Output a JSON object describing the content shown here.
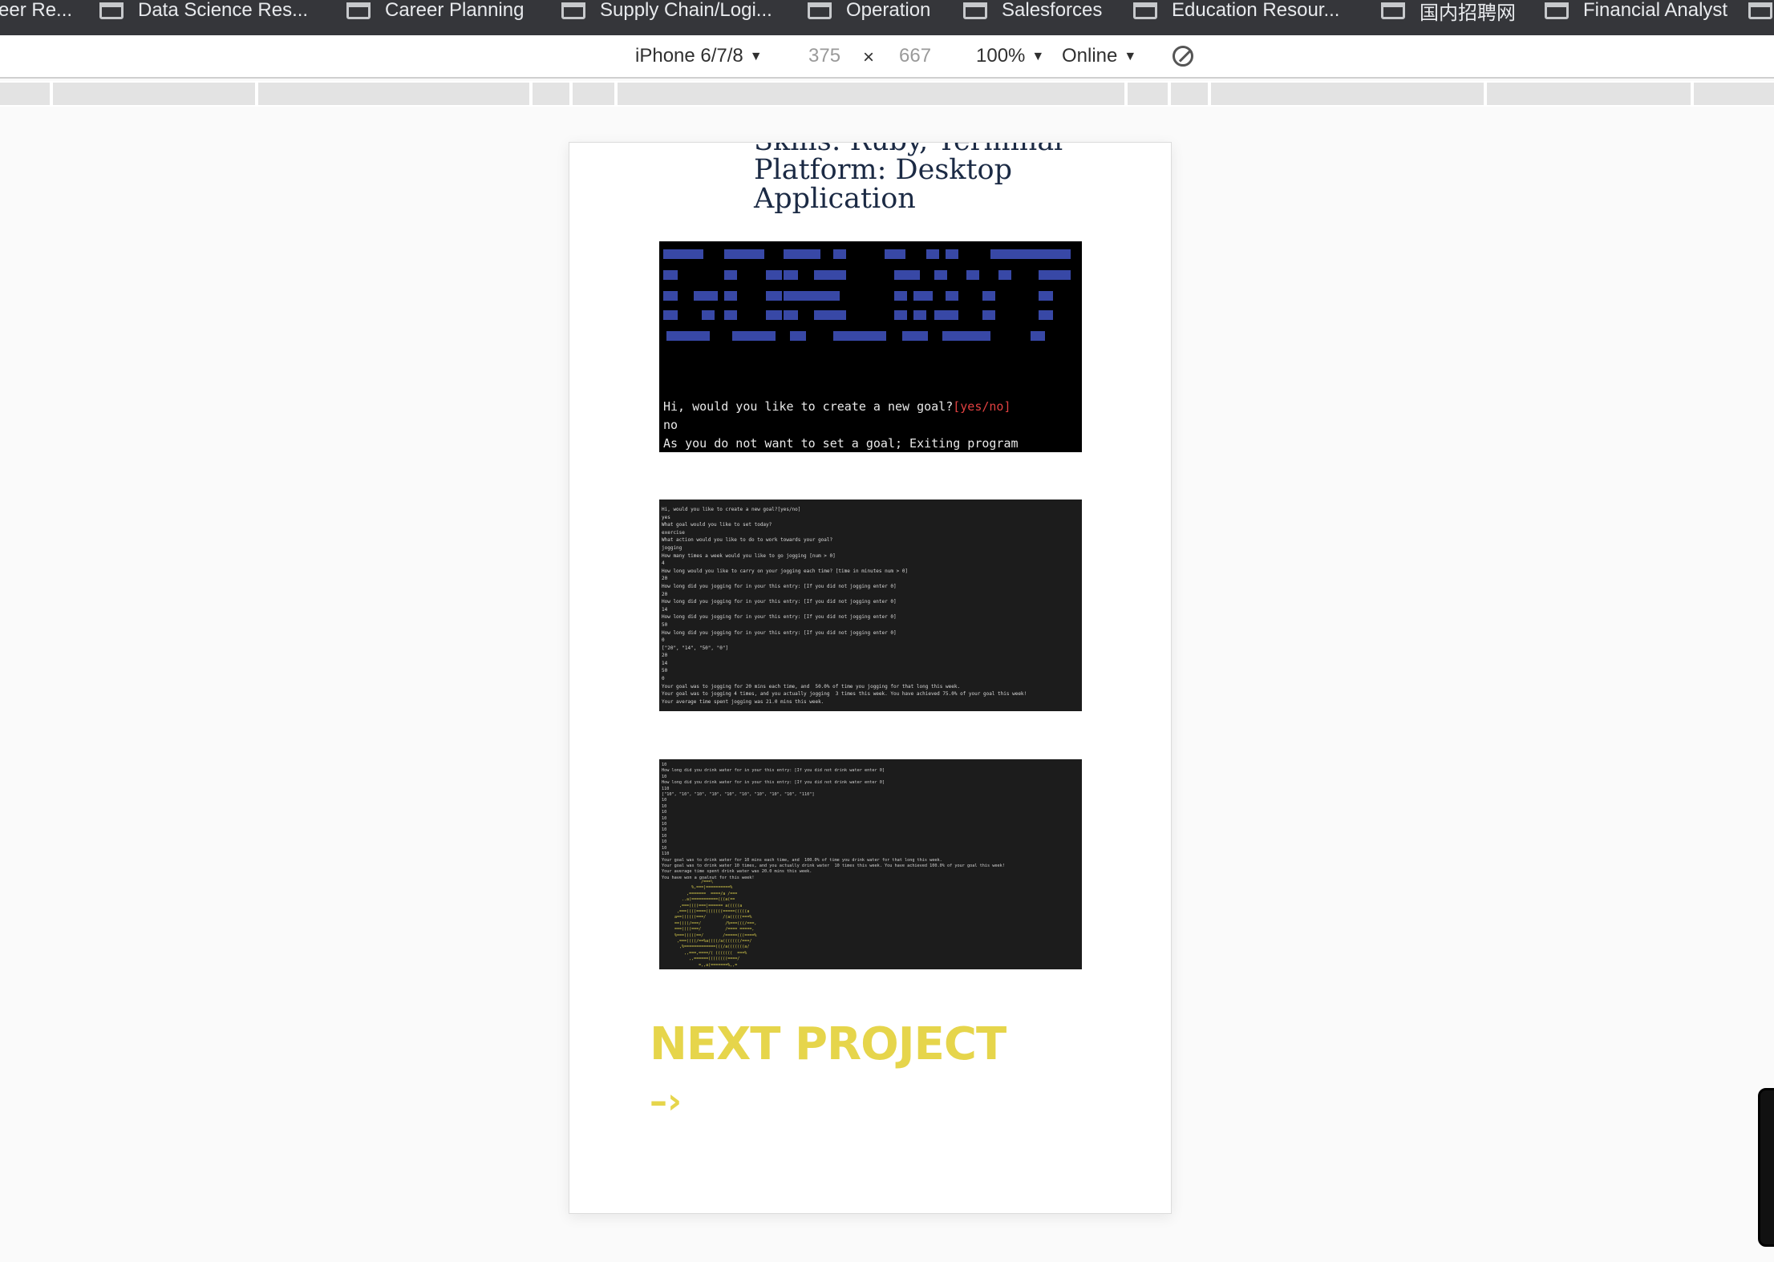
{
  "bookmarks": [
    "eer Re...",
    "Data Science Res...",
    "Career Planning",
    "Supply Chain/Logi...",
    "Operation",
    "Salesforces",
    "Education Resour...",
    "国内招聘网",
    "Financial Analyst"
  ],
  "devtools": {
    "device": "iPhone 6/7/8",
    "width": "375",
    "times": "×",
    "height": "667",
    "zoom": "100%",
    "network": "Online",
    "dropdown_glyph": "▼"
  },
  "project": {
    "skills": "Skills: Ruby, Terminal",
    "platform_line1": "Platform: Desktop",
    "platform_line2": "Application"
  },
  "shot1": {
    "prompt": "Hi, would you like to create a new goal?",
    "options": "[yes/no]",
    "answer": "no",
    "exit": "As you do not want to set a goal; Exiting program"
  },
  "shot2": {
    "text": "Hi, would you like to create a new goal?[yes/no]\nyes\nWhat goal would you like to set today?\nexercise\nWhat action would you like to do to work towards your goal?\njogging\nHow many times a week would you like to go jogging [num > 0]\n4\nHow long would you like to carry on your jogging each time? [time in minutes num > 0]\n20\nHow long did you jogging for in your this entry: [If you did not jogging enter 0]\n20\nHow long did you jogging for in your this entry: [If you did not jogging enter 0]\n14\nHow long did you jogging for in your this entry: [If you did not jogging enter 0]\n50\nHow long did you jogging for in your this entry: [If you did not jogging enter 0]\n0\n[\"20\", \"14\", \"50\", \"0\"]\n20\n14\n50\n0\nYour goal was to jogging for 20 mins each time, and  50.0% of time you jogging for that long this week.\nYour goal was to jogging 4 times, and you actually jogging  3 times this week. You have achieved 75.0% of your goal this week!\nYour average time spent jogging was 21.0 mins this week."
  },
  "shot3": {
    "text": "10\nHow long did you drink water for in your this entry: [If you did not drink water enter 0]\n10\nHow long did you drink water for in your this entry: [If you did not drink water enter 0]\n110\n[\"10\", \"10\", \"10\", \"10\", \"10\", \"10\", \"10\", \"10\", \"10\", \"110\"]\n10\n10\n10\n10\n10\n10\n10\n10\n10\n110\nYour goal was to drink water for 10 mins each time, and  100.0% of time you drink water for that long this week.\nYour goal was to drink water 10 times, and you actually drink water  10 times this week. You have achieved 100.0% of your goal this week!\nYour average time spent drink water was 20.0 mins this week.\nYou have won a goalnut for this week!",
    "art": "            /===\\\n        %,===|==========%\n      ,=======  ====/a /===\n    ..a(===========(((a(==\n   ,===((((===|====== a(((((a\n  ,===((((====(((((((=====(((((a\n a==((((((===/       /(a(((((===%\n ==((((/===/          /%===(((/===,\n ===((((===/          /==== =====,\n %===(((((==/        /=====(((====%\n  ,===((((/==%a((((/a(((((((/===/\n   ,%=============(((/a(((((((a/\n     ,,===,====/( (((((((  ===%\n       ,,======((((((((====/\n           =,,a(=======%,,="
  },
  "next_project": {
    "label": "NEXT PROJECT",
    "arrow": "–›"
  },
  "colors": {
    "accent": "#e6d54b",
    "heading": "#1b2a44",
    "banner_blue": "#3848a6"
  }
}
